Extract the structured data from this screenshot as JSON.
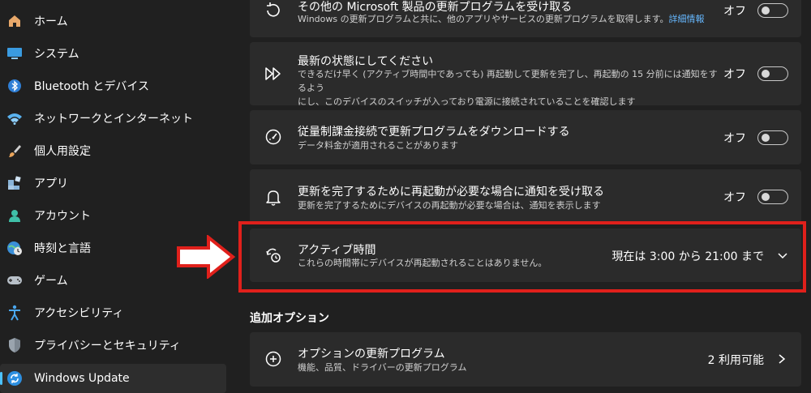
{
  "sidebar": {
    "items": [
      {
        "label": "ホーム",
        "icon": "home-icon"
      },
      {
        "label": "システム",
        "icon": "system-icon"
      },
      {
        "label": "Bluetooth とデバイス",
        "icon": "bluetooth-icon"
      },
      {
        "label": "ネットワークとインターネット",
        "icon": "wifi-icon"
      },
      {
        "label": "個人用設定",
        "icon": "brush-icon"
      },
      {
        "label": "アプリ",
        "icon": "apps-icon"
      },
      {
        "label": "アカウント",
        "icon": "account-icon"
      },
      {
        "label": "時刻と言語",
        "icon": "globe-clock-icon"
      },
      {
        "label": "ゲーム",
        "icon": "gamepad-icon"
      },
      {
        "label": "アクセシビリティ",
        "icon": "accessibility-icon"
      },
      {
        "label": "プライバシーとセキュリティ",
        "icon": "shield-icon"
      },
      {
        "label": "Windows Update",
        "icon": "update-icon",
        "active": true
      }
    ]
  },
  "main": {
    "other_products": {
      "title": "その他の Microsoft 製品の更新プログラムを受け取る",
      "desc": "Windows の更新プログラムと共に、他のアプリやサービスの更新プログラムを取得します。",
      "link": "詳細情報",
      "toggle_label": "オフ"
    },
    "get_latest": {
      "title": "最新の状態にしてください",
      "desc_line1": "できるだけ早く (アクティブ時間中であっても) 再起動して更新を完了し、再起動の 15 分前には通知をするよう",
      "desc_line2": "にし、このデバイスのスイッチが入っており電源に接続されていることを確認します",
      "toggle_label": "オフ"
    },
    "metered": {
      "title": "従量制課金接続で更新プログラムをダウンロードする",
      "desc": "データ料金が適用されることがあります",
      "toggle_label": "オフ"
    },
    "notify_restart": {
      "title": "更新を完了するために再起動が必要な場合に通知を受け取る",
      "desc": "更新を完了するためにデバイスの再起動が必要な場合は、通知を表示します",
      "toggle_label": "オフ"
    },
    "active_hours": {
      "title": "アクティブ時間",
      "desc": "これらの時間帯にデバイスが再起動されることはありません。",
      "value": "現在は 3:00 から 21:00 まで"
    },
    "additional_options_title": "追加オプション",
    "optional_updates": {
      "title": "オプションの更新プログラム",
      "desc": "機能、品質、ドライバーの更新プログラム",
      "value": "2 利用可能"
    }
  },
  "colors": {
    "accent": "#4cc2ff",
    "annotation": "#e0201b",
    "card_bg": "#2b2b2b",
    "page_bg": "#202020"
  }
}
